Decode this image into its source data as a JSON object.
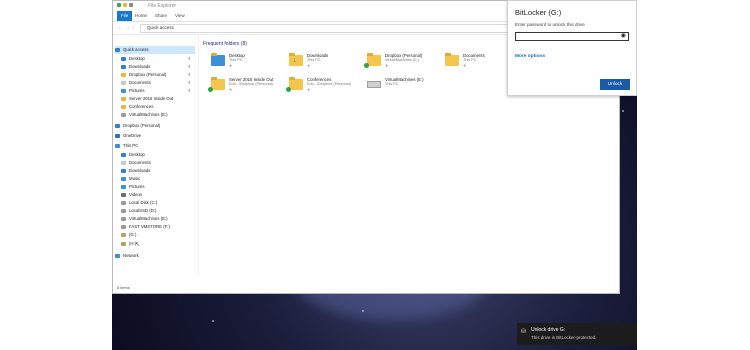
{
  "explorer": {
    "title": "File Explorer",
    "ribbon_tabs": [
      "File",
      "Home",
      "Share",
      "View"
    ],
    "address_path": "Quick access",
    "nav": {
      "quick_access": "Quick access",
      "qa_items": [
        "Desktop",
        "Downloads",
        "Dropbox (Personal)",
        "Documents",
        "Pictures",
        "Server 2016 Inside Out",
        "Conferences",
        "VirtualMachines (E:)"
      ],
      "dropbox": "Dropbox (Personal)",
      "onedrive": "OneDrive",
      "this_pc": "This PC",
      "pc_items": [
        "Desktop",
        "Documents",
        "Downloads",
        "Music",
        "Pictures",
        "Videos",
        "Local Disk (C:)",
        "LocalSSD (D:)",
        "VirtualMachines (E:)",
        "FAST VMSTORE (F:)",
        "(G:)",
        "(H:)"
      ],
      "network": "Network"
    },
    "frequent_header": "Frequent folders (8)",
    "folders": [
      {
        "name": "Desktop",
        "sub": "This PC"
      },
      {
        "name": "Downloads",
        "sub": "This PC"
      },
      {
        "name": "Dropbox (Personal)",
        "sub": "VirtualMachines (E:)"
      },
      {
        "name": "Documents",
        "sub": "This PC"
      },
      {
        "name": "Server 2016 Inside Out",
        "sub": "Edu...\\Dropbox (Personal)"
      },
      {
        "name": "Conferences",
        "sub": "Edu...\\Dropbox (Personal)"
      },
      {
        "name": "VirtualMachines (E:)",
        "sub": "This PC"
      }
    ],
    "status": "8 items"
  },
  "bitlocker": {
    "title": "BitLocker (G:)",
    "prompt": "Enter password to unlock this drive",
    "eye_icon": "eye-icon",
    "more_options": "More options",
    "unlock_label": "Unlock"
  },
  "toast": {
    "title": "Unlock drive G:",
    "body": "This drive is BitLocker-protected."
  }
}
